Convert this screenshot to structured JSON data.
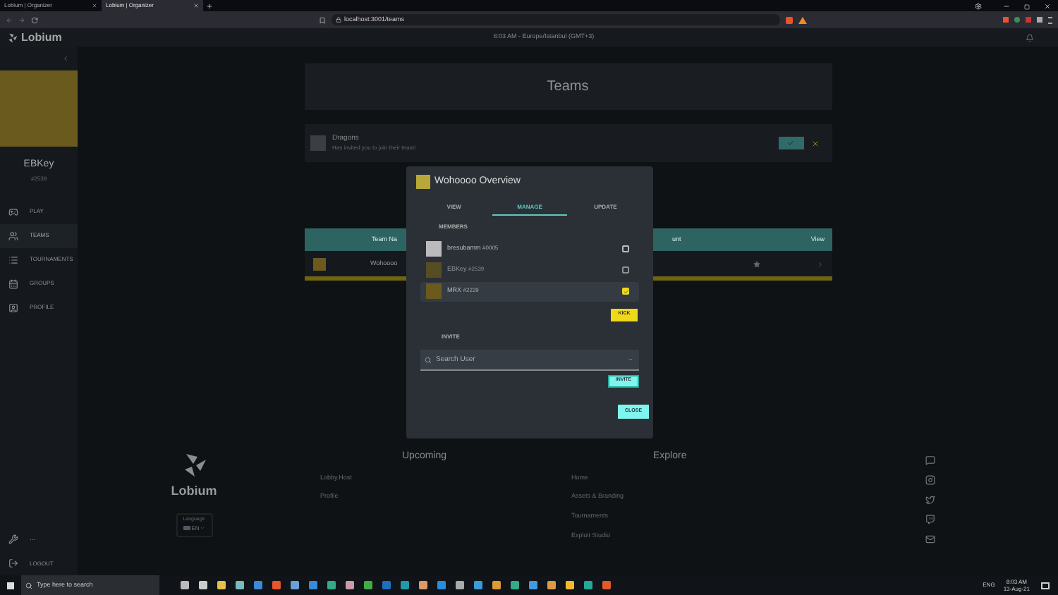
{
  "browser": {
    "tabs": [
      {
        "title": "Lobium | Organizer",
        "selected": false
      },
      {
        "title": "Lobium | Organizer",
        "selected": true
      }
    ],
    "address": "localhost:3001/teams"
  },
  "header": {
    "logo": "Lobium",
    "clock": "8:03 AM - Europe/Istanbul (GMT+3)"
  },
  "sidebar": {
    "username": "EBKey",
    "tag": "#2539",
    "items": [
      {
        "label": "PLAY",
        "selected": false
      },
      {
        "label": "TEAMS",
        "selected": true
      },
      {
        "label": "TOURNAMENTS",
        "selected": false
      },
      {
        "label": "GROUPS",
        "selected": false
      },
      {
        "label": "PROFILE",
        "selected": false
      }
    ],
    "tools_label": "...",
    "logout": "LOGOUT"
  },
  "page": {
    "title": "Teams",
    "invite": {
      "team": "Dragons",
      "message": "Has invited you to join their team!"
    },
    "table": {
      "columns": [
        "Team Na",
        "unt",
        "View"
      ],
      "rows": [
        {
          "name": "Wohoooo"
        }
      ]
    }
  },
  "modal": {
    "title": "Wohoooo Overview",
    "tabs": [
      {
        "label": "VIEW",
        "selected": false
      },
      {
        "label": "MANAGE",
        "selected": true
      },
      {
        "label": "UPDATE",
        "selected": false
      }
    ],
    "members_label": "MEMBERS",
    "members": [
      {
        "name": "bresubamm",
        "tag": "#0005",
        "checked": false,
        "disabled": false
      },
      {
        "name": "EBKey",
        "tag": "#2539",
        "checked": false,
        "disabled": true
      },
      {
        "name": "MRX",
        "tag": "#2229",
        "checked": true,
        "disabled": false
      }
    ],
    "kick": "KICK",
    "invite_label": "INVITE",
    "search_placeholder": "Search User",
    "invite_button": "INVITE",
    "close": "CLOSE"
  },
  "footer": {
    "logo": "Lobium",
    "language_label": "Language",
    "language": "EN",
    "columns": [
      {
        "title": "Upcoming",
        "links": [
          "Lobby.Host",
          "Profile"
        ]
      },
      {
        "title": "Explore",
        "links": [
          "Home",
          "Assets & Branding",
          "Tournaments",
          "Exploit Studio"
        ]
      }
    ]
  },
  "taskbar": {
    "search": "Type here to search",
    "language": "ENG",
    "time": "8:03 AM",
    "date": "13-Aug-21"
  }
}
